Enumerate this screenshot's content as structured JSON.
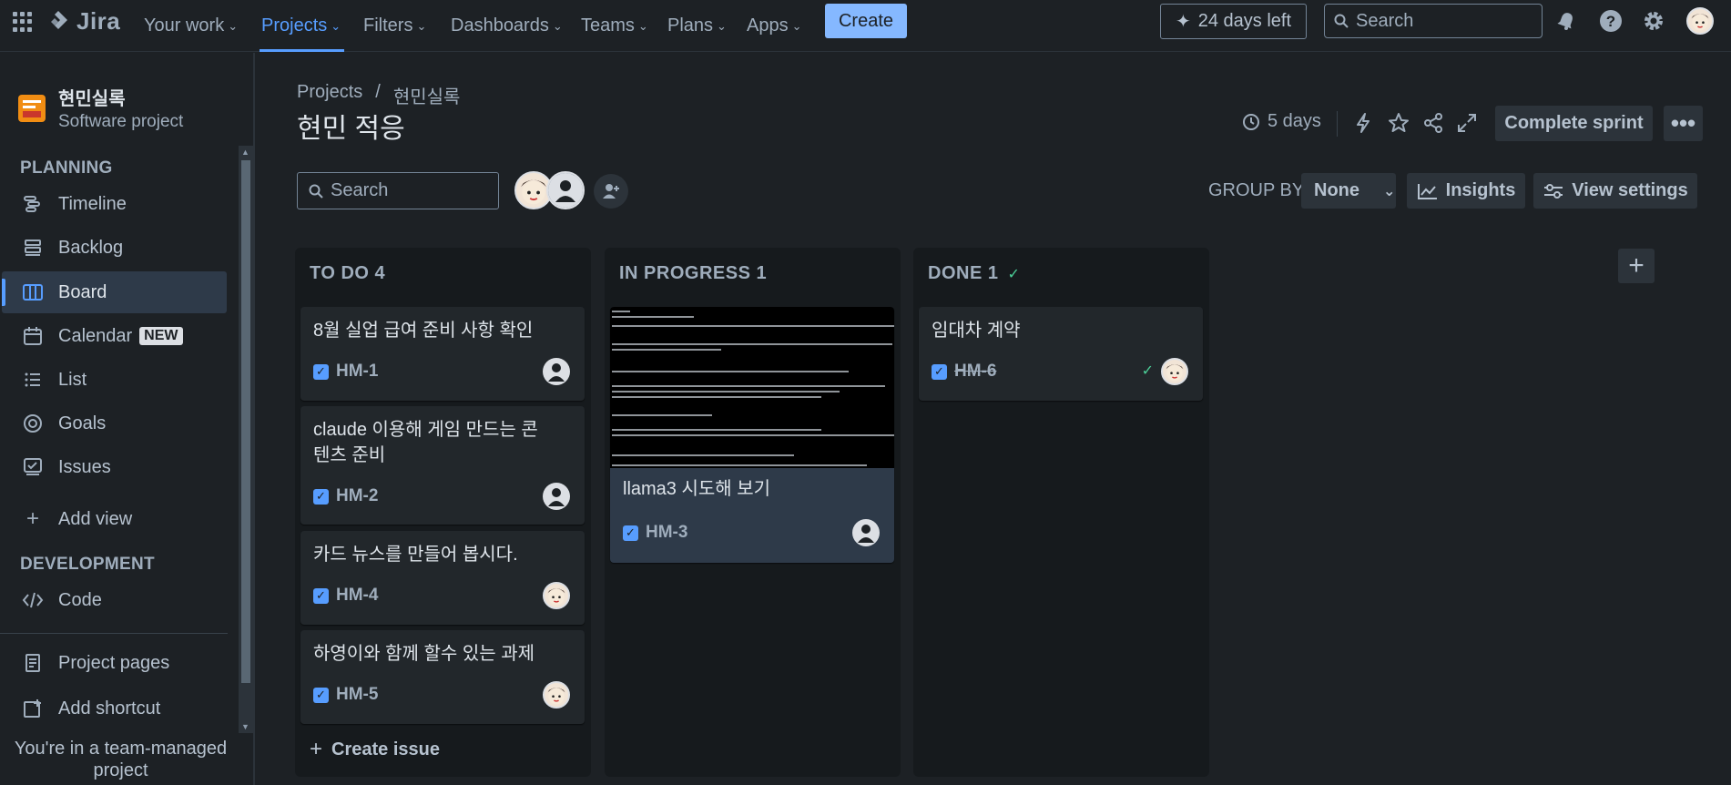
{
  "topnav": {
    "logo_text": "Jira",
    "items": [
      {
        "label": "Your work"
      },
      {
        "label": "Projects",
        "active": true
      },
      {
        "label": "Filters"
      },
      {
        "label": "Dashboards"
      },
      {
        "label": "Teams"
      },
      {
        "label": "Plans"
      },
      {
        "label": "Apps"
      }
    ],
    "create_label": "Create",
    "trial_label": "24 days left",
    "search_placeholder": "Search",
    "icons": [
      "notifications-icon",
      "help-icon",
      "settings-icon",
      "profile-avatar"
    ]
  },
  "sidebar": {
    "project_name": "현민실록",
    "project_type": "Software project",
    "planning_heading": "PLANNING",
    "planning_items": [
      {
        "label": "Timeline",
        "icon": "timeline-icon"
      },
      {
        "label": "Backlog",
        "icon": "backlog-icon"
      },
      {
        "label": "Board",
        "icon": "board-icon",
        "active": true
      },
      {
        "label": "Calendar",
        "icon": "calendar-icon",
        "badge": "NEW"
      },
      {
        "label": "List",
        "icon": "list-icon"
      },
      {
        "label": "Goals",
        "icon": "goals-icon"
      },
      {
        "label": "Issues",
        "icon": "issues-icon"
      }
    ],
    "add_view_label": "Add view",
    "development_heading": "DEVELOPMENT",
    "code_label": "Code",
    "project_pages_label": "Project pages",
    "add_shortcut_label": "Add shortcut",
    "footer_text": "You're in a team-managed project"
  },
  "header": {
    "breadcrumb_root": "Projects",
    "breadcrumb_sep": "/",
    "breadcrumb_project": "현민실록",
    "title": "현민 적응",
    "days_left": "5 days",
    "complete_sprint_label": "Complete sprint",
    "search_placeholder": "Search",
    "group_by_label": "GROUP BY",
    "group_by_value": "None",
    "insights_label": "Insights",
    "view_settings_label": "View settings"
  },
  "board": {
    "columns": [
      {
        "title": "TO DO 4",
        "cards": [
          {
            "title": "8월 실업 급여 준비 사항 확인",
            "key": "HM-1",
            "assignee": "unassigned"
          },
          {
            "title": "claude 이용해 게임 만드는 콘텐츠 준비",
            "key": "HM-2",
            "assignee": "unassigned"
          },
          {
            "title": "카드 뉴스를 만들어 봅시다.",
            "key": "HM-4",
            "assignee": "user"
          },
          {
            "title": "하영이와 함께 할수 있는 과제",
            "key": "HM-5",
            "assignee": "user"
          }
        ],
        "create_issue_label": "Create issue"
      },
      {
        "title": "IN PROGRESS 1",
        "cards": [
          {
            "title": "llama3 시도해 보기",
            "key": "HM-3",
            "assignee": "unassigned",
            "has_cover": true
          }
        ]
      },
      {
        "title": "DONE 1",
        "cards": [
          {
            "title": "임대차 계약",
            "key": "HM-6",
            "assignee": "user",
            "done": true
          }
        ]
      }
    ]
  },
  "colors": {
    "background": "#1d2125",
    "accent": "#579dff",
    "create_button": "#85b8ff",
    "column_bg": "#161a1d",
    "card_bg": "#22272b"
  }
}
